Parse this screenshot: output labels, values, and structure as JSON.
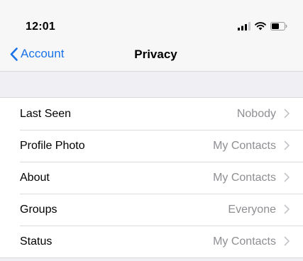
{
  "status": {
    "time": "12:01",
    "icons": [
      "signal-icon",
      "wifi-icon",
      "battery-icon"
    ]
  },
  "nav": {
    "back_label": "Account",
    "title": "Privacy"
  },
  "colors": {
    "accent": "#1a73e8",
    "secondary_text": "#8e8e93",
    "background": "#efeff4"
  },
  "settings": [
    {
      "label": "Last Seen",
      "value": "Nobody"
    },
    {
      "label": "Profile Photo",
      "value": "My Contacts"
    },
    {
      "label": "About",
      "value": "My Contacts"
    },
    {
      "label": "Groups",
      "value": "Everyone"
    },
    {
      "label": "Status",
      "value": "My Contacts"
    }
  ]
}
